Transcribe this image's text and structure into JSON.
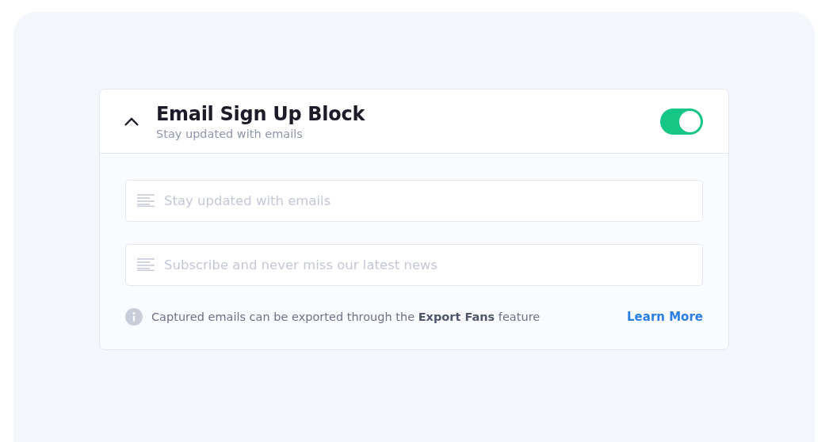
{
  "block": {
    "title": "Email Sign Up Block",
    "subtitle": "Stay updated with emails",
    "expanded": true,
    "enabled": true,
    "fields": [
      {
        "placeholder": "Stay updated with emails"
      },
      {
        "placeholder": "Subscribe and never miss our latest news"
      }
    ],
    "note": "Captured emails can be exported through the **Export Fans** feature",
    "link": "Learn More"
  }
}
